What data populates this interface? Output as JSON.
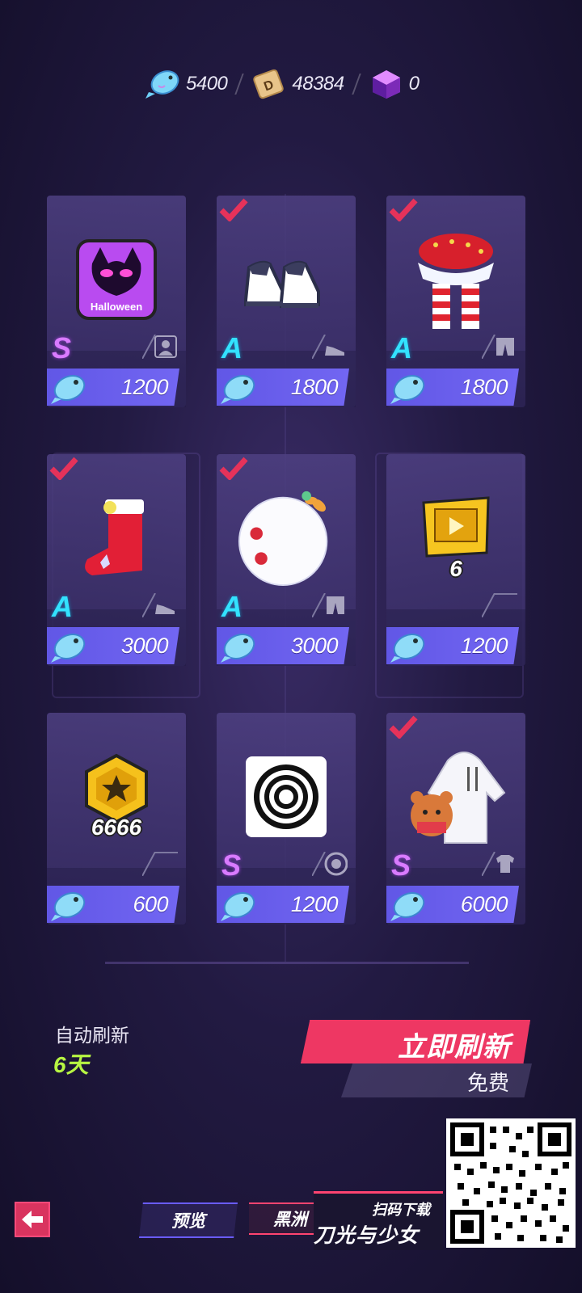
{
  "currencies": [
    {
      "icon": "fish-coin-icon",
      "value": "5400"
    },
    {
      "icon": "dice-ticket-icon",
      "value": "48384"
    },
    {
      "icon": "purple-cube-icon",
      "value": "0"
    }
  ],
  "shop_items": [
    {
      "name": "halloween-avatar-frame",
      "rank": "S",
      "type_icon": "avatar-icon",
      "price": "1200",
      "checked": false
    },
    {
      "name": "sneakers",
      "rank": "A",
      "type_icon": "shoe-icon",
      "price": "1800",
      "checked": true
    },
    {
      "name": "christmas-skirt-stockings",
      "rank": "A",
      "type_icon": "pants-icon",
      "price": "1800",
      "checked": true
    },
    {
      "name": "christmas-boot",
      "rank": "A",
      "type_icon": "shoe-icon",
      "price": "3000",
      "checked": true
    },
    {
      "name": "snowball-costume",
      "rank": "A",
      "type_icon": "pants-icon",
      "price": "3000",
      "checked": true
    },
    {
      "name": "video-ticket",
      "rank": "",
      "quantity": "6",
      "type_icon": "",
      "price": "1200",
      "checked": false
    },
    {
      "name": "star-coin",
      "rank": "",
      "quantity": "6666",
      "type_icon": "",
      "price": "600",
      "checked": false
    },
    {
      "name": "target-emblem",
      "rank": "S",
      "type_icon": "target-icon",
      "price": "1200",
      "checked": false
    },
    {
      "name": "bear-hoodie",
      "rank": "S",
      "type_icon": "shirt-icon",
      "price": "6000",
      "checked": true
    }
  ],
  "refresh": {
    "auto_label": "自动刷新",
    "auto_days": "6天",
    "refresh_button": "立即刷新",
    "cost_label": "免费"
  },
  "bottom_nav": {
    "preview_tab": "预览",
    "black_tab": "黑洲"
  },
  "promo": {
    "scan_label": "扫码下载",
    "title": "刀光与少女"
  },
  "colors": {
    "accent_pink": "#ee3763",
    "price_bar": "#6157e6",
    "rank_s": "#d97bff",
    "rank_a": "#33e2ff",
    "days_green": "#b7f542"
  }
}
